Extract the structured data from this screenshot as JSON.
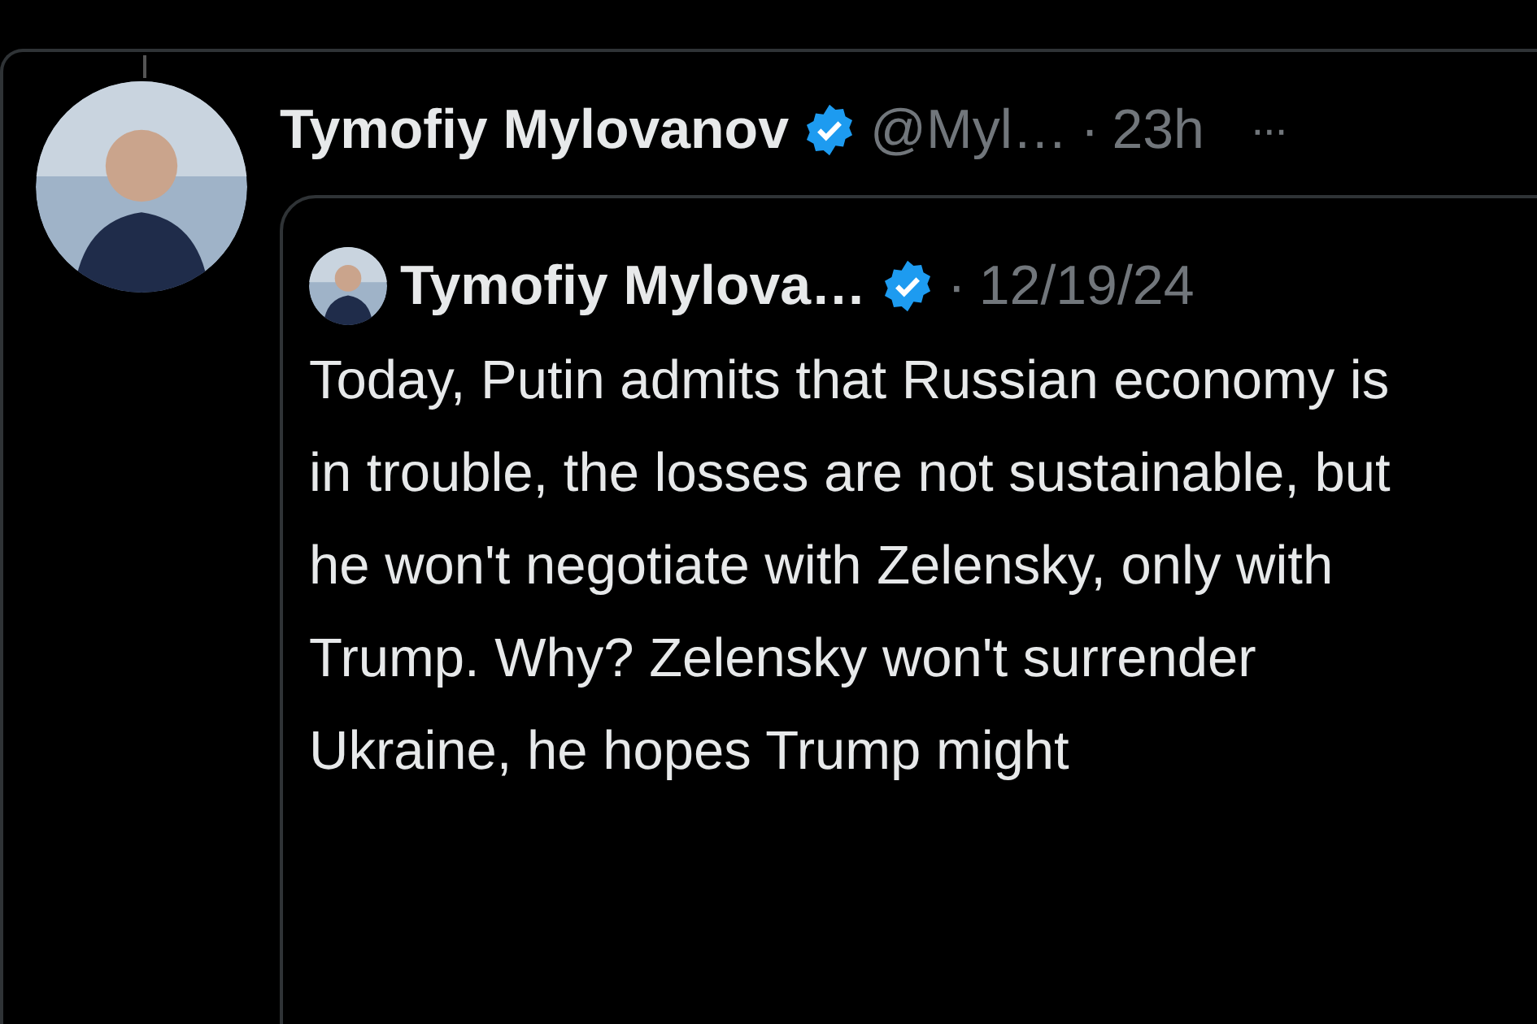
{
  "post": {
    "author": "Tymofiy Mylovanov",
    "verified": true,
    "handle": "@Myl…",
    "separator": "·",
    "time": "23h",
    "more": "···",
    "quote": {
      "author": "Tymofiy Mylova…",
      "verified": true,
      "separator": "·",
      "date": "12/19/24",
      "text": "Today, Putin admits that Russian economy is in trouble, the losses are not sustainable, but he won't negotiate with Zelensky, only with Trump. Why? Zelensky won't surrender Ukraine, he hopes Trump might"
    }
  }
}
